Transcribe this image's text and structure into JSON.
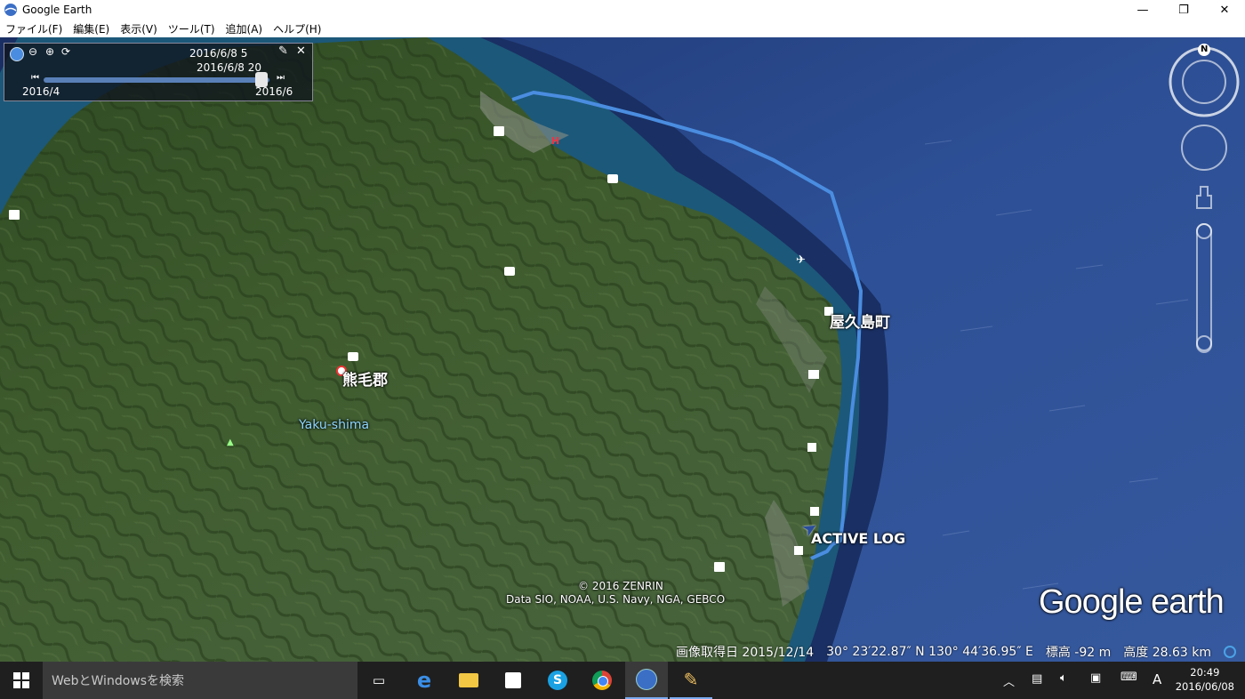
{
  "window": {
    "title": "Google Earth"
  },
  "menu": [
    "ファイル(F)",
    "編集(E)",
    "表示(V)",
    "ツール(T)",
    "追加(A)",
    "ヘルプ(H)"
  ],
  "timeslider": {
    "top_label": "2016/6/8  5",
    "current_label": "2016/6/8  20",
    "start_label": "2016/4",
    "end_label": "2016/6",
    "position": 0.97
  },
  "map_labels": {
    "town": "屋久島町",
    "district": "熊毛郡",
    "island": "Yaku-shima",
    "log": "ACTIVE LOG",
    "copyright_1": "© 2016 ZENRIN",
    "copyright_2": "Data SIO, NOAA, U.S. Navy, NGA, GEBCO",
    "logo": "Google earth",
    "compass_n": "N"
  },
  "status": {
    "imagery_date": "画像取得日  2015/12/14",
    "coords": "30° 23′22.87″ N  130° 44′36.95″ E",
    "elevation": "標高    -92  m",
    "altitude": "高度  28.63 km"
  },
  "taskbar": {
    "search_placeholder": "WebとWindowsを検索",
    "time": "20:49",
    "date": "2016/06/08",
    "ime": "A"
  },
  "colors": {
    "track": "#4a8de0",
    "ocean": "#2a4b8a",
    "land": "#3f5a2c",
    "taskbar": "#1f1f1f"
  }
}
